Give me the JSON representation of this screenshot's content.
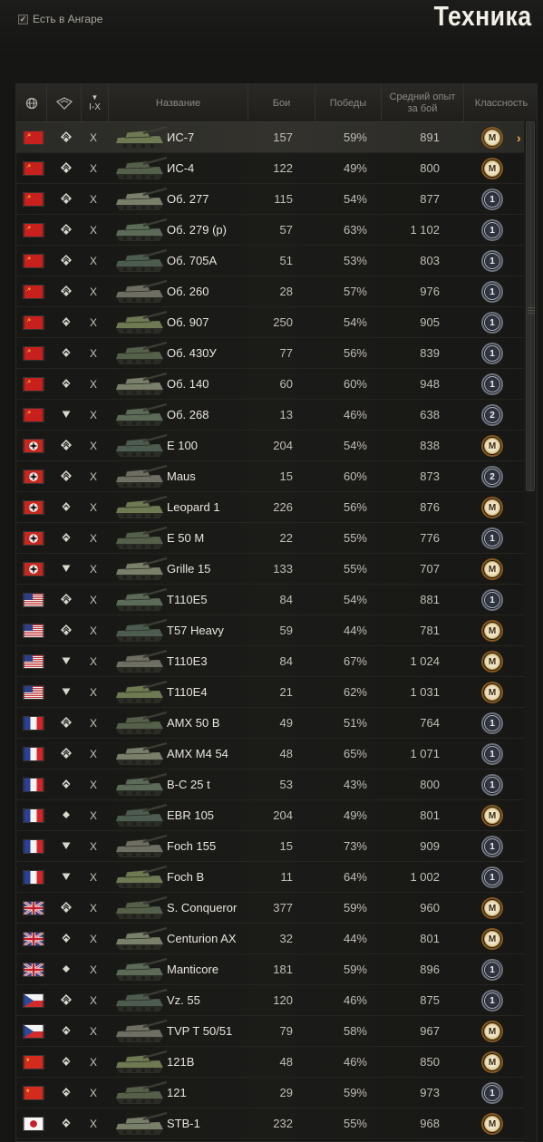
{
  "header": {
    "hangar_label": "Есть в Ангаре",
    "hangar_checked": true,
    "title": "Техника"
  },
  "columns": {
    "nation": "",
    "type": "",
    "tier": "I-X",
    "name": "Название",
    "battles": "Бои",
    "wins": "Победы",
    "avg_xp": "Средний опыт за бой",
    "mastery": "Классность"
  },
  "rows": [
    {
      "nation": "ussr",
      "type": "heavy",
      "tier": "X",
      "name": "ИС-7",
      "battles": "157",
      "wins": "59%",
      "avg_xp": "891",
      "mastery": "M",
      "selected": true
    },
    {
      "nation": "ussr",
      "type": "heavy",
      "tier": "X",
      "name": "ИС-4",
      "battles": "122",
      "wins": "49%",
      "avg_xp": "800",
      "mastery": "M"
    },
    {
      "nation": "ussr",
      "type": "heavy",
      "tier": "X",
      "name": "Об. 277",
      "battles": "115",
      "wins": "54%",
      "avg_xp": "877",
      "mastery": "1"
    },
    {
      "nation": "ussr",
      "type": "heavy",
      "tier": "X",
      "name": "Об. 279 (р)",
      "battles": "57",
      "wins": "63%",
      "avg_xp": "1 102",
      "mastery": "1"
    },
    {
      "nation": "ussr",
      "type": "heavy",
      "tier": "X",
      "name": "Об. 705А",
      "battles": "51",
      "wins": "53%",
      "avg_xp": "803",
      "mastery": "1"
    },
    {
      "nation": "ussr",
      "type": "heavy",
      "tier": "X",
      "name": "Об. 260",
      "battles": "28",
      "wins": "57%",
      "avg_xp": "976",
      "mastery": "1"
    },
    {
      "nation": "ussr",
      "type": "medium",
      "tier": "X",
      "name": "Об. 907",
      "battles": "250",
      "wins": "54%",
      "avg_xp": "905",
      "mastery": "1"
    },
    {
      "nation": "ussr",
      "type": "medium",
      "tier": "X",
      "name": "Об. 430У",
      "battles": "77",
      "wins": "56%",
      "avg_xp": "839",
      "mastery": "1"
    },
    {
      "nation": "ussr",
      "type": "medium",
      "tier": "X",
      "name": "Об. 140",
      "battles": "60",
      "wins": "60%",
      "avg_xp": "948",
      "mastery": "1"
    },
    {
      "nation": "ussr",
      "type": "td",
      "tier": "X",
      "name": "Об. 268",
      "battles": "13",
      "wins": "46%",
      "avg_xp": "638",
      "mastery": "2"
    },
    {
      "nation": "germany",
      "type": "heavy",
      "tier": "X",
      "name": "E 100",
      "battles": "204",
      "wins": "54%",
      "avg_xp": "838",
      "mastery": "M"
    },
    {
      "nation": "germany",
      "type": "heavy",
      "tier": "X",
      "name": "Maus",
      "battles": "15",
      "wins": "60%",
      "avg_xp": "873",
      "mastery": "2"
    },
    {
      "nation": "germany",
      "type": "medium",
      "tier": "X",
      "name": "Leopard 1",
      "battles": "226",
      "wins": "56%",
      "avg_xp": "876",
      "mastery": "M"
    },
    {
      "nation": "germany",
      "type": "medium",
      "tier": "X",
      "name": "E 50 M",
      "battles": "22",
      "wins": "55%",
      "avg_xp": "776",
      "mastery": "1"
    },
    {
      "nation": "germany",
      "type": "td",
      "tier": "X",
      "name": "Grille 15",
      "battles": "133",
      "wins": "55%",
      "avg_xp": "707",
      "mastery": "M"
    },
    {
      "nation": "usa",
      "type": "heavy",
      "tier": "X",
      "name": "T110E5",
      "battles": "84",
      "wins": "54%",
      "avg_xp": "881",
      "mastery": "1"
    },
    {
      "nation": "usa",
      "type": "heavy",
      "tier": "X",
      "name": "T57 Heavy",
      "battles": "59",
      "wins": "44%",
      "avg_xp": "781",
      "mastery": "M"
    },
    {
      "nation": "usa",
      "type": "td",
      "tier": "X",
      "name": "T110E3",
      "battles": "84",
      "wins": "67%",
      "avg_xp": "1 024",
      "mastery": "M"
    },
    {
      "nation": "usa",
      "type": "td",
      "tier": "X",
      "name": "T110E4",
      "battles": "21",
      "wins": "62%",
      "avg_xp": "1 031",
      "mastery": "M"
    },
    {
      "nation": "france",
      "type": "heavy",
      "tier": "X",
      "name": "AMX 50 B",
      "battles": "49",
      "wins": "51%",
      "avg_xp": "764",
      "mastery": "1"
    },
    {
      "nation": "france",
      "type": "heavy",
      "tier": "X",
      "name": "AMX M4 54",
      "battles": "48",
      "wins": "65%",
      "avg_xp": "1 071",
      "mastery": "1"
    },
    {
      "nation": "france",
      "type": "medium",
      "tier": "X",
      "name": "B-C 25 t",
      "battles": "53",
      "wins": "43%",
      "avg_xp": "800",
      "mastery": "1"
    },
    {
      "nation": "france",
      "type": "light",
      "tier": "X",
      "name": "EBR 105",
      "battles": "204",
      "wins": "49%",
      "avg_xp": "801",
      "mastery": "M"
    },
    {
      "nation": "france",
      "type": "td",
      "tier": "X",
      "name": "Foch 155",
      "battles": "15",
      "wins": "73%",
      "avg_xp": "909",
      "mastery": "1"
    },
    {
      "nation": "france",
      "type": "td",
      "tier": "X",
      "name": "Foch B",
      "battles": "11",
      "wins": "64%",
      "avg_xp": "1 002",
      "mastery": "1"
    },
    {
      "nation": "uk",
      "type": "heavy",
      "tier": "X",
      "name": "S. Conqueror",
      "battles": "377",
      "wins": "59%",
      "avg_xp": "960",
      "mastery": "M"
    },
    {
      "nation": "uk",
      "type": "medium",
      "tier": "X",
      "name": "Centurion AX",
      "battles": "32",
      "wins": "44%",
      "avg_xp": "801",
      "mastery": "M"
    },
    {
      "nation": "uk",
      "type": "light",
      "tier": "X",
      "name": "Manticore",
      "battles": "181",
      "wins": "59%",
      "avg_xp": "896",
      "mastery": "1"
    },
    {
      "nation": "czech",
      "type": "heavy",
      "tier": "X",
      "name": "Vz. 55",
      "battles": "120",
      "wins": "46%",
      "avg_xp": "875",
      "mastery": "1"
    },
    {
      "nation": "czech",
      "type": "medium",
      "tier": "X",
      "name": "TVP T 50/51",
      "battles": "79",
      "wins": "58%",
      "avg_xp": "967",
      "mastery": "M"
    },
    {
      "nation": "china",
      "type": "medium",
      "tier": "X",
      "name": "121B",
      "battles": "48",
      "wins": "46%",
      "avg_xp": "850",
      "mastery": "M"
    },
    {
      "nation": "china",
      "type": "medium",
      "tier": "X",
      "name": "121",
      "battles": "29",
      "wins": "59%",
      "avg_xp": "973",
      "mastery": "1"
    },
    {
      "nation": "japan",
      "type": "medium",
      "tier": "X",
      "name": "STB-1",
      "battles": "232",
      "wins": "55%",
      "avg_xp": "968",
      "mastery": "M"
    }
  ],
  "colors": {
    "accent_arrow": "#f0b34a",
    "mastery_master": "#c8a357",
    "mastery_class": "#aab4c2"
  }
}
